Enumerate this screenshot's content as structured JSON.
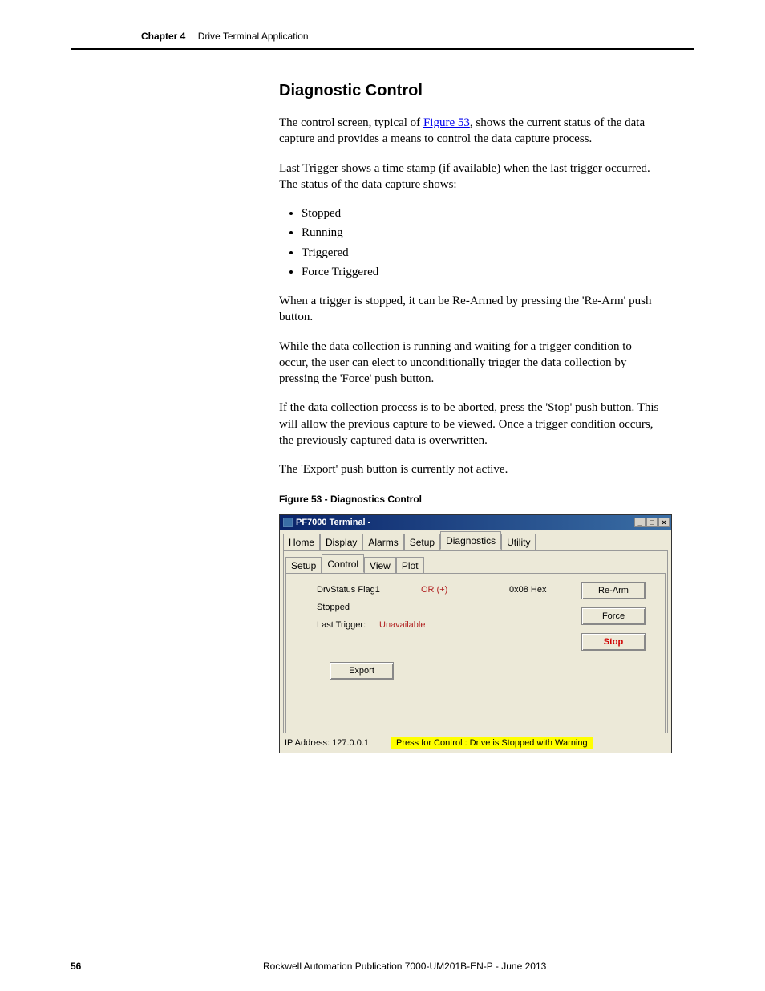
{
  "header": {
    "chapter_label": "Chapter 4",
    "chapter_title": "Drive Terminal Application"
  },
  "section": {
    "title": "Diagnostic Control",
    "p1_pre": "The control screen, typical of ",
    "p1_link": "Figure 53",
    "p1_post": ", shows the current status of the data capture and provides a means to control the data capture process.",
    "p2": "Last Trigger shows a time stamp (if available) when the last trigger occurred. The status of the data capture shows:",
    "statuses": [
      "Stopped",
      "Running",
      "Triggered",
      "Force Triggered"
    ],
    "p3": "When a trigger is stopped, it can be Re-Armed by pressing the 'Re-Arm' push button.",
    "p4": "While the data collection is running and waiting for a trigger condition to occur, the user can elect to unconditionally trigger the data collection by pressing the 'Force' push button.",
    "p5": "If the data collection process is to be aborted, press the 'Stop' push button. This will allow the previous capture to be viewed. Once a trigger condition occurs, the previously captured data is overwritten.",
    "p6": "The 'Export' push button is currently not active.",
    "figure_caption": "Figure 53 - Diagnostics Control"
  },
  "app": {
    "window_title": "PF7000 Terminal -",
    "title_buttons": {
      "min": "_",
      "max": "□",
      "close": "×"
    },
    "top_tabs": [
      "Home",
      "Display",
      "Alarms",
      "Setup",
      "Diagnostics",
      "Utility"
    ],
    "top_tabs_active": 4,
    "sub_tabs": [
      "Setup",
      "Control",
      "View",
      "Plot"
    ],
    "sub_tabs_active": 1,
    "panel": {
      "flag_label": "DrvStatus Flag1",
      "operator": "OR (+)",
      "hex_value": "0x08  Hex",
      "state": "Stopped",
      "last_trigger_label": "Last Trigger:",
      "last_trigger_value": "Unavailable",
      "buttons": {
        "rearm": "Re-Arm",
        "force": "Force",
        "stop": "Stop",
        "export": "Export"
      }
    },
    "status": {
      "ip_label": "IP Address: 127.0.0.1",
      "message": "Press for Control : Drive is Stopped with Warning"
    }
  },
  "footer": {
    "page_number": "56",
    "publication": "Rockwell Automation Publication 7000-UM201B-EN-P - June 2013"
  }
}
